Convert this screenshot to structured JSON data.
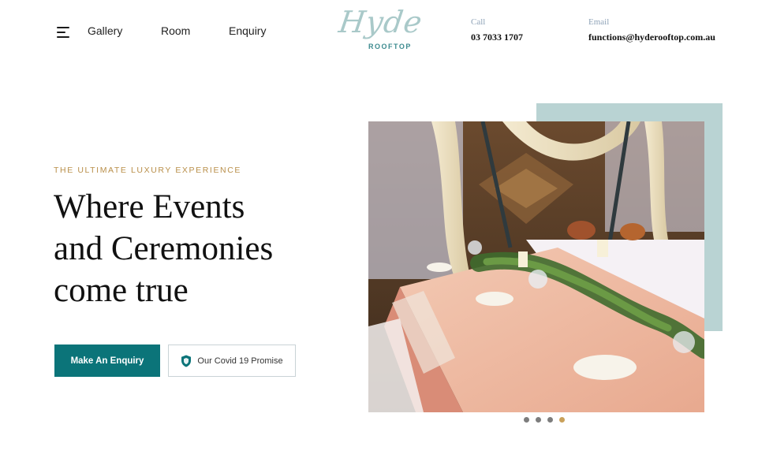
{
  "header": {
    "nav": [
      {
        "label": "Gallery"
      },
      {
        "label": "Room"
      },
      {
        "label": "Enquiry"
      }
    ],
    "logo": {
      "script": "Hyde",
      "sub": "ROOFTOP"
    },
    "call": {
      "label": "Call",
      "value": "03 7033 1707"
    },
    "email": {
      "label": "Email",
      "value": "functions@hyderooftop.com.au"
    }
  },
  "hero": {
    "eyebrow": "THE ULTIMATE LUXURY EXPERIENCE",
    "headline": [
      "Where Events",
      "and Ceremonies",
      "come true"
    ],
    "primary_button": "Make An Enquiry",
    "secondary_button": "Our Covid 19 Promise"
  },
  "slider": {
    "dots": 4,
    "active_index": 3
  },
  "colors": {
    "accent": "#0b7479",
    "gold": "#b98f4a",
    "teal_block": "#b9d3d3"
  }
}
